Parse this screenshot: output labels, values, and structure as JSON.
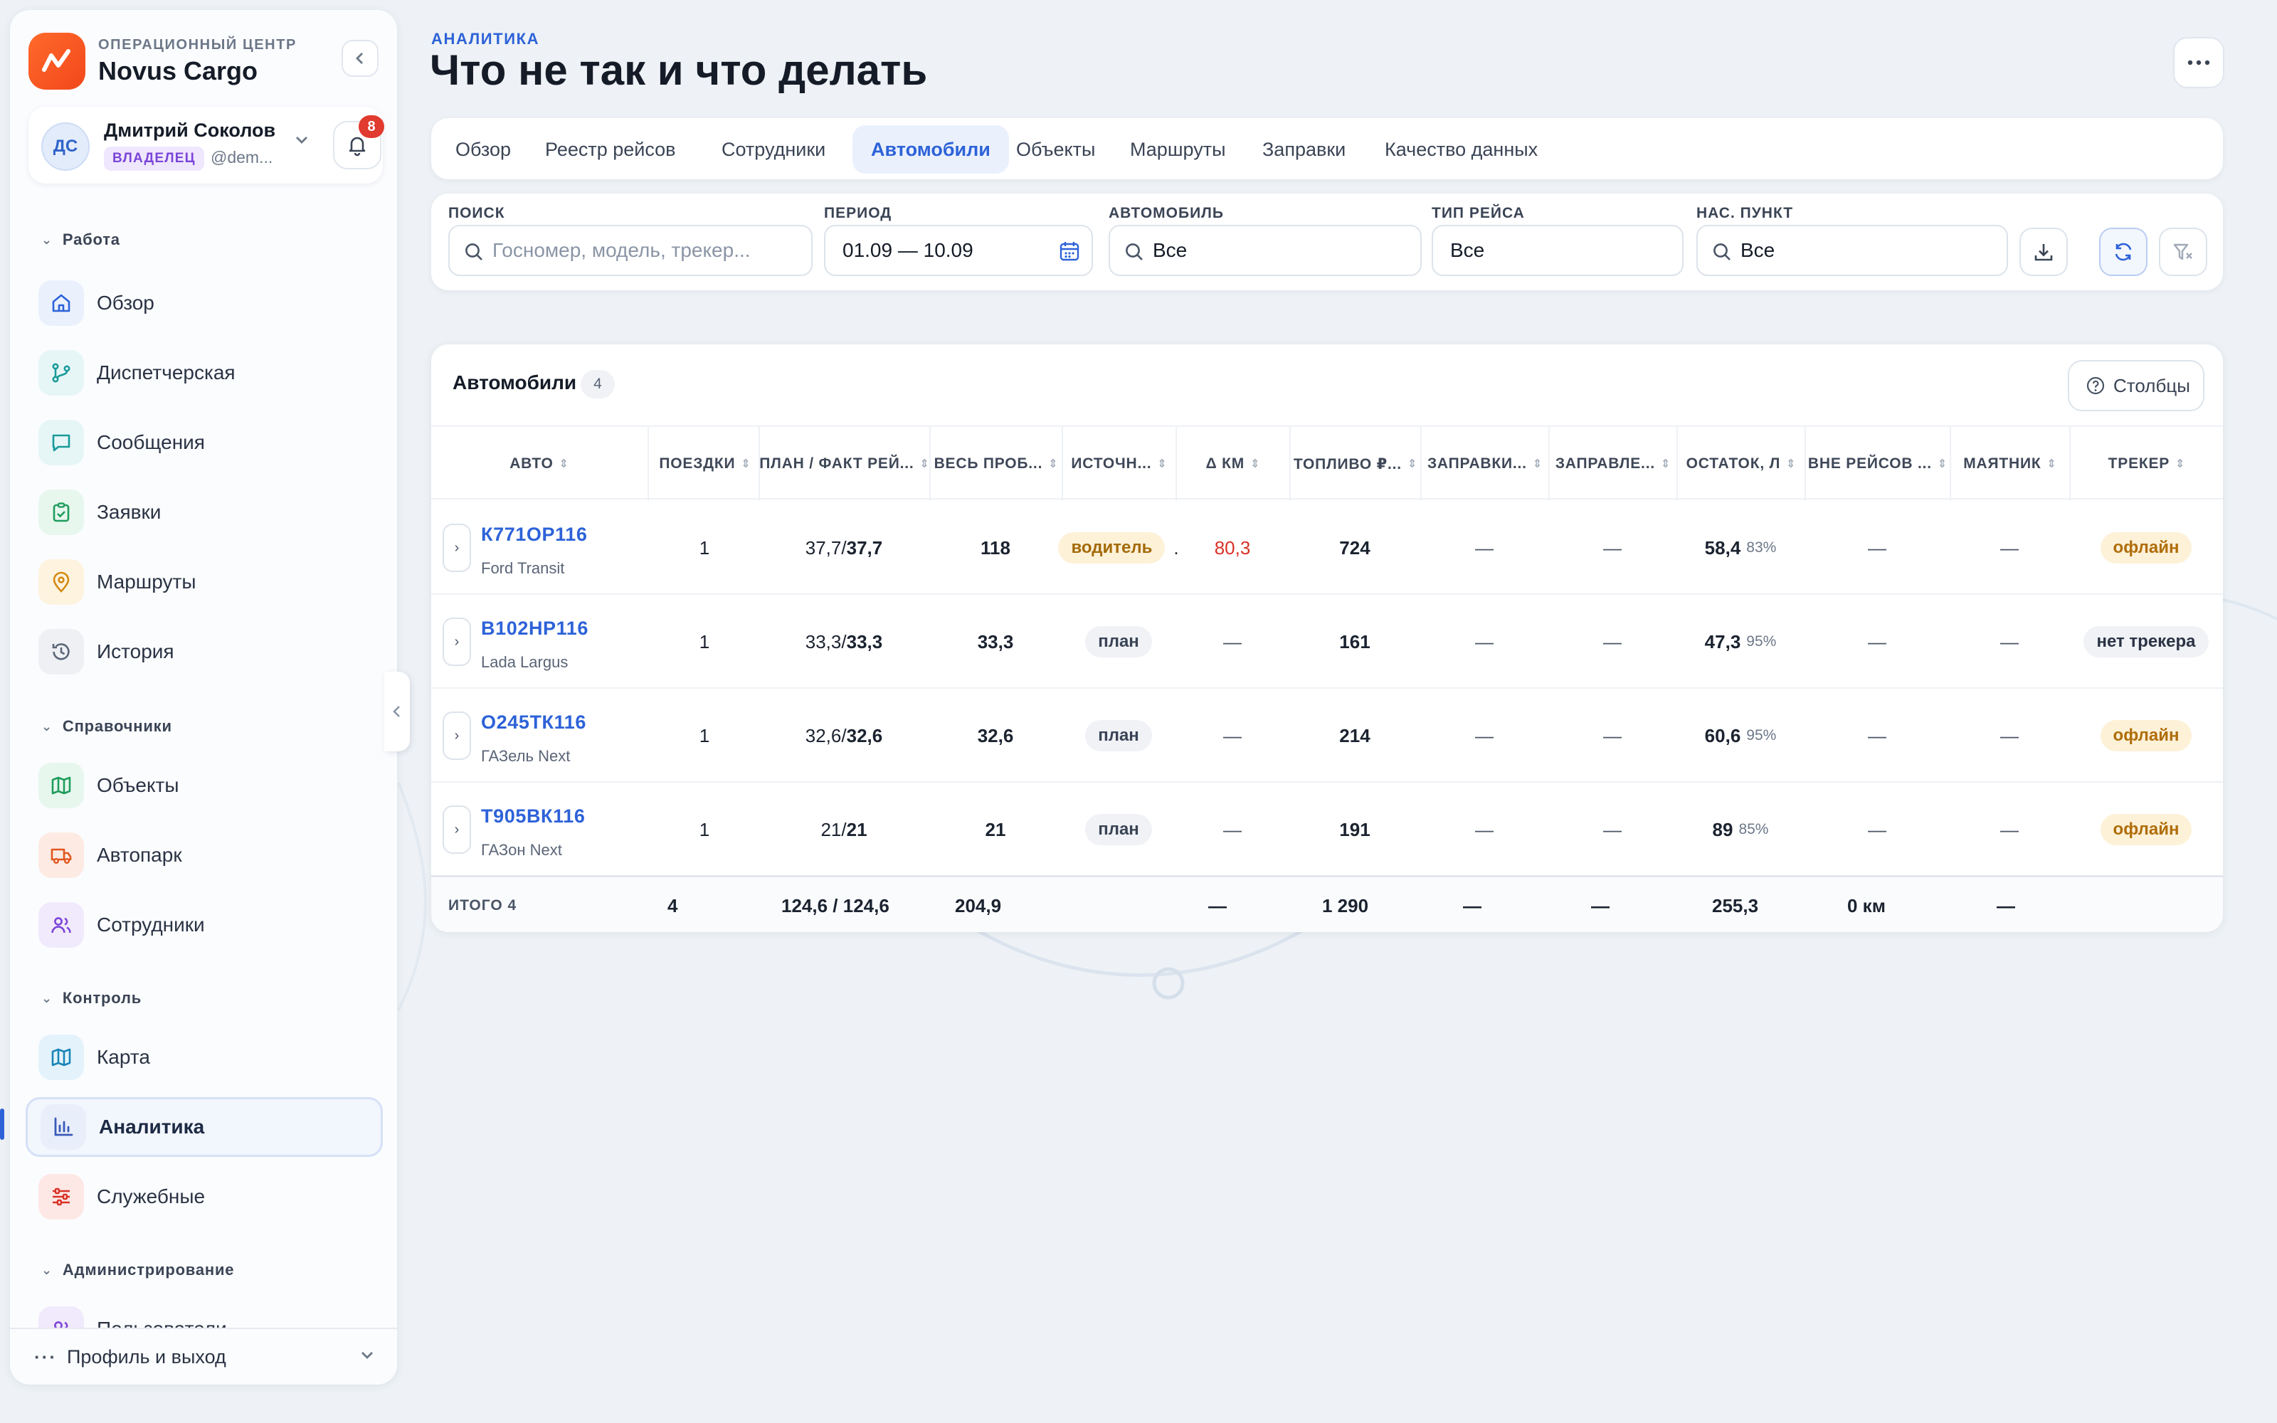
{
  "brand": {
    "subtitle": "ОПЕРАЦИОННЫЙ ЦЕНТР",
    "name": "Novus Cargo",
    "color": "#f4521f"
  },
  "user": {
    "initials": "ДС",
    "name": "Дмитрий Соколов",
    "role": "ВЛАДЕЛЕЦ",
    "handle": "@dem...",
    "notifications": "8"
  },
  "sidebar": {
    "sections": [
      {
        "title": "Работа",
        "items": [
          {
            "label": "Обзор",
            "icon": "home-icon"
          },
          {
            "label": "Диспетчерская",
            "icon": "route-icon"
          },
          {
            "label": "Сообщения",
            "icon": "chat-icon"
          },
          {
            "label": "Заявки",
            "icon": "clipboard-icon"
          },
          {
            "label": "Маршруты",
            "icon": "map-pin-icon"
          },
          {
            "label": "История",
            "icon": "history-icon"
          }
        ]
      },
      {
        "title": "Справочники",
        "items": [
          {
            "label": "Объекты",
            "icon": "map-icon"
          },
          {
            "label": "Автопарк",
            "icon": "truck-icon"
          },
          {
            "label": "Сотрудники",
            "icon": "users-icon"
          }
        ]
      },
      {
        "title": "Контроль",
        "items": [
          {
            "label": "Карта",
            "icon": "map-icon"
          },
          {
            "label": "Аналитика",
            "icon": "chart-icon",
            "active": true
          },
          {
            "label": "Служебные",
            "icon": "sliders-icon"
          }
        ]
      },
      {
        "title": "Администрирование",
        "items": [
          {
            "label": "Пользователи",
            "icon": "users-icon"
          }
        ]
      }
    ],
    "profile_label": "Профиль и выход"
  },
  "header": {
    "eyebrow": "АНАЛИТИКА",
    "title": "Что не так и что делать"
  },
  "tabs": [
    "Обзор",
    "Реестр рейсов",
    "Сотрудники",
    "Автомобили",
    "Объекты",
    "Маршруты",
    "Заправки",
    "Качество данных"
  ],
  "active_tab": "Автомобили",
  "filters": {
    "search": {
      "label": "ПОИСК",
      "placeholder": "Госномер, модель, трекер..."
    },
    "period": {
      "label": "ПЕРИОД",
      "value": "01.09 — 10.09"
    },
    "vehicle": {
      "label": "АВТОМОБИЛЬ",
      "value": "Все"
    },
    "trip_type": {
      "label": "ТИП РЕЙСА",
      "value": "Все"
    },
    "locality": {
      "label": "НАС. ПУНКТ",
      "value": "Все"
    }
  },
  "table": {
    "title": "Автомобили",
    "count": "4",
    "columns_button": "Столбцы",
    "headers": [
      "АВТО",
      "ПОЕЗДКИ",
      "ПЛАН / ФАКТ РЕЙ...",
      "ВЕСЬ ПРОБ...",
      "ИСТОЧН...",
      "Δ КМ",
      "ТОПЛИВО ₽...",
      "ЗАПРАВКИ...",
      "ЗАПРАВЛЕ...",
      "ОСТАТОК, Л",
      "ВНЕ РЕЙСОВ ...",
      "МАЯТНИК",
      "ТРЕКЕР"
    ],
    "rows": [
      {
        "plate": "К771ОР116",
        "model": "Ford Transit",
        "trips": "1",
        "plan": "37,7",
        "fact": "37,7",
        "mileage": "118",
        "source": "водитель",
        "source_extra": ".",
        "delta": "80,3",
        "fuel": "724",
        "refuels": "—",
        "refueled": "—",
        "rest": "58,4",
        "rest_pct": "83%",
        "offtrip": "—",
        "pendulum": "—",
        "tracker": "офлайн"
      },
      {
        "plate": "В102НР116",
        "model": "Lada Largus",
        "trips": "1",
        "plan": "33,3",
        "fact": "33,3",
        "mileage": "33,3",
        "source": "план",
        "source_extra": "",
        "delta": "—",
        "fuel": "161",
        "refuels": "—",
        "refueled": "—",
        "rest": "47,3",
        "rest_pct": "95%",
        "offtrip": "—",
        "pendulum": "—",
        "tracker": "нет трекера"
      },
      {
        "plate": "О245ТК116",
        "model": "ГАЗель Next",
        "trips": "1",
        "plan": "32,6",
        "fact": "32,6",
        "mileage": "32,6",
        "source": "план",
        "source_extra": "",
        "delta": "—",
        "fuel": "214",
        "refuels": "—",
        "refueled": "—",
        "rest": "60,6",
        "rest_pct": "95%",
        "offtrip": "—",
        "pendulum": "—",
        "tracker": "офлайн"
      },
      {
        "plate": "Т905ВК116",
        "model": "ГАЗон Next",
        "trips": "1",
        "plan": "21",
        "fact": "21",
        "mileage": "21",
        "source": "план",
        "source_extra": "",
        "delta": "—",
        "fuel": "191",
        "refuels": "—",
        "refueled": "—",
        "rest": "89",
        "rest_pct": "85%",
        "offtrip": "—",
        "pendulum": "—",
        "tracker": "офлайн"
      }
    ],
    "footer": {
      "label": "ИТОГО 4",
      "trips": "4",
      "plan_fact": "124,6 / 124,6",
      "mileage": "204,9",
      "delta": "—",
      "fuel": "1 290",
      "refuels": "—",
      "refueled": "—",
      "rest": "255,3",
      "offtrip": "0 км",
      "pendulum": "—"
    }
  },
  "colors": {
    "accent": "#2d62d8",
    "danger": "#d93227",
    "warning": "#b06d08"
  }
}
